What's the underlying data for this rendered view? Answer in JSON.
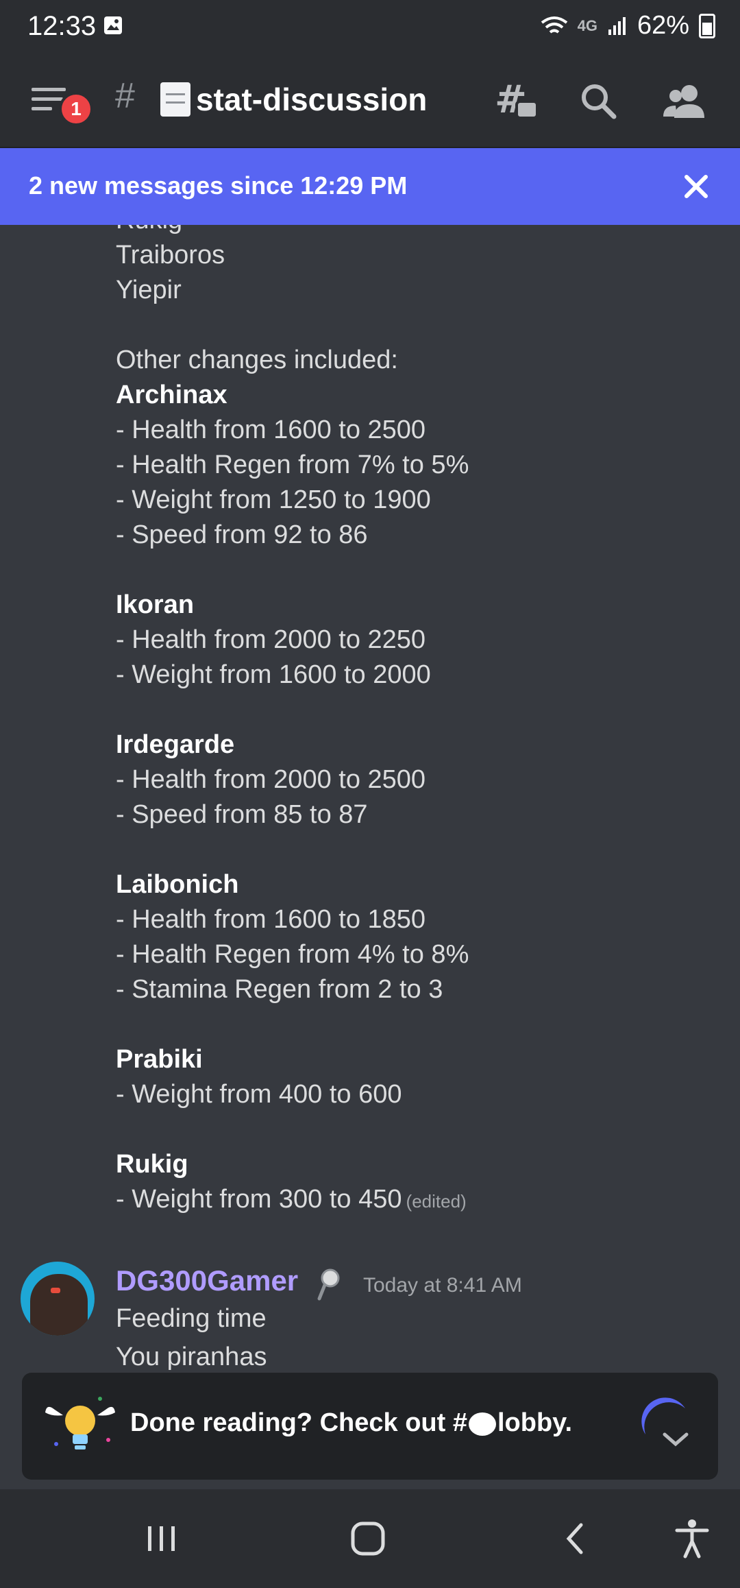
{
  "status_bar": {
    "time": "12:33",
    "network": "4G",
    "battery": "62%"
  },
  "header": {
    "notification_count": "1",
    "channel_hash": "#",
    "channel_name": "stat-discussion"
  },
  "banner": {
    "text": "2 new messages since 12:29 PM"
  },
  "message1": {
    "lines": [
      {
        "text": "Rukig",
        "bold": false
      },
      {
        "text": "Traiboros",
        "bold": false
      },
      {
        "text": "Yiepir",
        "bold": false
      },
      {
        "text": "",
        "bold": false
      },
      {
        "text": "Other changes included:",
        "bold": false
      },
      {
        "text": "Archinax",
        "bold": true
      },
      {
        "text": "- Health from 1600 to 2500",
        "bold": false
      },
      {
        "text": "- Health Regen from 7% to 5%",
        "bold": false
      },
      {
        "text": "- Weight from 1250 to 1900",
        "bold": false
      },
      {
        "text": "- Speed from 92 to 86",
        "bold": false
      },
      {
        "text": "",
        "bold": false
      },
      {
        "text": "Ikoran",
        "bold": true
      },
      {
        "text": "- Health from 2000 to 2250",
        "bold": false
      },
      {
        "text": "- Weight from 1600 to 2000",
        "bold": false
      },
      {
        "text": "",
        "bold": false
      },
      {
        "text": "Irdegarde",
        "bold": true
      },
      {
        "text": "- Health from 2000 to 2500",
        "bold": false
      },
      {
        "text": "- Speed from 85 to 87",
        "bold": false
      },
      {
        "text": "",
        "bold": false
      },
      {
        "text": "Laibonich",
        "bold": true
      },
      {
        "text": "- Health from 1600 to 1850",
        "bold": false
      },
      {
        "text": "- Health Regen from 4% to 8%",
        "bold": false
      },
      {
        "text": "- Stamina Regen from 2 to 3",
        "bold": false
      },
      {
        "text": "",
        "bold": false
      },
      {
        "text": "Prabiki",
        "bold": true
      },
      {
        "text": "- Weight from 400 to 600",
        "bold": false
      },
      {
        "text": "",
        "bold": false
      },
      {
        "text": "Rukig",
        "bold": true
      },
      {
        "text": "- Weight from 300 to 450",
        "bold": false
      }
    ],
    "edited_label": "(edited)"
  },
  "message2": {
    "username": "DG300Gamer",
    "timestamp": "Today at 8:41 AM",
    "line1": "Feeding time",
    "line2": "You piranhas"
  },
  "toast": {
    "text_before": "Done reading? Check out #",
    "text_after": "lobby."
  },
  "colors": {
    "background": "#36393f",
    "bar": "#2b2d31",
    "accent": "#5865f2",
    "username": "#b09cff",
    "badge": "#ed4245"
  }
}
